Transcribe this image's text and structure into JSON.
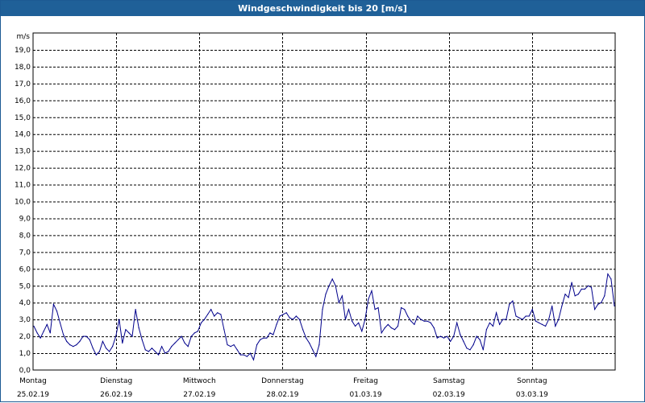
{
  "window": {
    "title": "Windgeschwindigkeit bis 20 [m/s]"
  },
  "chart_data": {
    "type": "line",
    "title": "Windgeschwindigkeit bis 20 [m/s]",
    "ylabel": "m/s",
    "xlabel": "",
    "ylim": [
      0,
      20
    ],
    "grid": true,
    "y_ticks": [
      "0,0",
      "1,0",
      "2,0",
      "3,0",
      "4,0",
      "5,0",
      "6,0",
      "7,0",
      "8,0",
      "9,0",
      "10,0",
      "11,0",
      "12,0",
      "13,0",
      "14,0",
      "15,0",
      "16,0",
      "17,0",
      "18,0",
      "19,0"
    ],
    "days": [
      {
        "name": "Montag",
        "date": "25.02.19"
      },
      {
        "name": "Dienstag",
        "date": "26.02.19"
      },
      {
        "name": "Mittwoch",
        "date": "27.02.19"
      },
      {
        "name": "Donnerstag",
        "date": "28.02.19"
      },
      {
        "name": "Freitag",
        "date": "01.03.19"
      },
      {
        "name": "Samstag",
        "date": "02.03.19"
      },
      {
        "name": "Sonntag",
        "date": "03.03.19"
      }
    ],
    "line_color": "#00008b",
    "series": [
      {
        "values": [
          2.6,
          2.2,
          1.9,
          2.3,
          2.7,
          2.2,
          3.9,
          3.5,
          2.8,
          2.1,
          1.7,
          1.5,
          1.4,
          1.5,
          1.7,
          2.0,
          2.0,
          1.8,
          1.3,
          0.9,
          1.1,
          1.7,
          1.3,
          1.1,
          1.4,
          2.0,
          3.0,
          1.6,
          2.4,
          2.2,
          2.0,
          3.6,
          2.5,
          1.8,
          1.2,
          1.1,
          1.3,
          1.1,
          0.9,
          1.4,
          1.0,
          1.1,
          1.4,
          1.6,
          1.8,
          2.0,
          1.6,
          1.4,
          2.0,
          2.2,
          2.3,
          2.8,
          3.0,
          3.3,
          3.6,
          3.2,
          3.4,
          3.3,
          2.4,
          1.5,
          1.4,
          1.5,
          1.2,
          0.9,
          0.9,
          0.8,
          1.0,
          0.6,
          1.5,
          1.8,
          1.9,
          1.9,
          2.2,
          2.1,
          2.7,
          3.2,
          3.3,
          3.4,
          3.1,
          3.0,
          3.2,
          3.0,
          2.4,
          1.9,
          1.6,
          1.2,
          0.8,
          1.5,
          3.6,
          4.5,
          5.0,
          5.4,
          5.0,
          4.0,
          4.4,
          3.0,
          3.6,
          2.9,
          2.6,
          2.8,
          2.3,
          3.0,
          4.2,
          4.7,
          3.6,
          3.7,
          2.2,
          2.5,
          2.7,
          2.5,
          2.4,
          2.6,
          3.7,
          3.6,
          3.2,
          2.9,
          2.7,
          3.2,
          3.0,
          2.9,
          2.9,
          2.8,
          2.5,
          1.9,
          2.0,
          1.9,
          2.0,
          1.7,
          2.0,
          2.8,
          2.1,
          1.7,
          1.3,
          1.2,
          1.5,
          2.0,
          1.8,
          1.2,
          2.4,
          2.8,
          2.6,
          3.4,
          2.7,
          3.0,
          3.0,
          3.9,
          4.1,
          3.2,
          3.1,
          3.0,
          3.2,
          3.2,
          3.6,
          2.9,
          2.8,
          2.7,
          2.6,
          3.0,
          3.8,
          2.6,
          3.0,
          3.8,
          4.5,
          4.3,
          5.2,
          4.4,
          4.5,
          4.8,
          4.8,
          5.0,
          4.9,
          3.6,
          3.9,
          4.0,
          4.4,
          5.7,
          5.4,
          3.8
        ]
      }
    ]
  }
}
